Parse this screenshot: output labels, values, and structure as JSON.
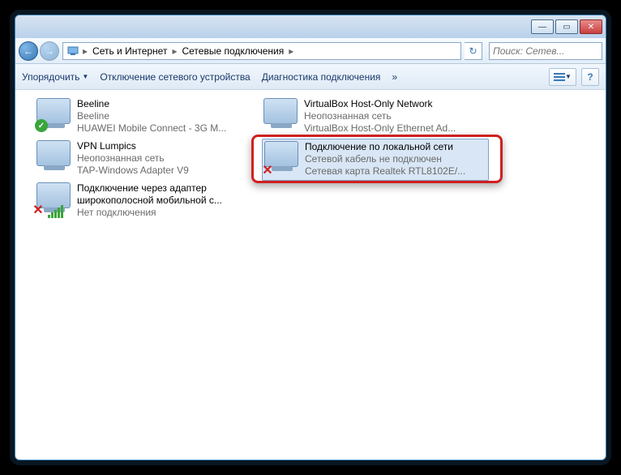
{
  "titlebar": {
    "min": "—",
    "max": "▭",
    "close": "✕"
  },
  "breadcrumb": {
    "root": "Сеть и Интернет",
    "current": "Сетевые подключения",
    "sep": "▸"
  },
  "refresh_glyph": "↻",
  "search": {
    "placeholder": "Поиск: Сетев...",
    "icon": "🔍"
  },
  "toolbar": {
    "organize": "Упорядочить",
    "disable": "Отключение сетевого устройства",
    "diagnose": "Диагностика подключения",
    "more": "»"
  },
  "connections": [
    {
      "name": "Beeline",
      "line2": "Beeline",
      "line3": "HUAWEI Mobile Connect - 3G M...",
      "badge": "green-check"
    },
    {
      "name": "VirtualBox Host-Only Network",
      "line2": "Неопознанная сеть",
      "line3": "VirtualBox Host-Only Ethernet Ad...",
      "badge": "none"
    },
    {
      "name": "VPN Lumpics",
      "line2": "Неопознанная сеть",
      "line3": "TAP-Windows Adapter V9",
      "badge": "none"
    },
    {
      "name": "Подключение по локальной сети",
      "line2": "Сетевой кабель не подключен",
      "line3": "Сетевая карта Realtek RTL8102E/...",
      "badge": "red-x"
    },
    {
      "name": "Подключение через адаптер широкополосной мобильной с...",
      "line2": "",
      "line3": "Нет подключения",
      "badge": "signal-x"
    }
  ],
  "nav": {
    "back": "←",
    "forward": "→"
  }
}
